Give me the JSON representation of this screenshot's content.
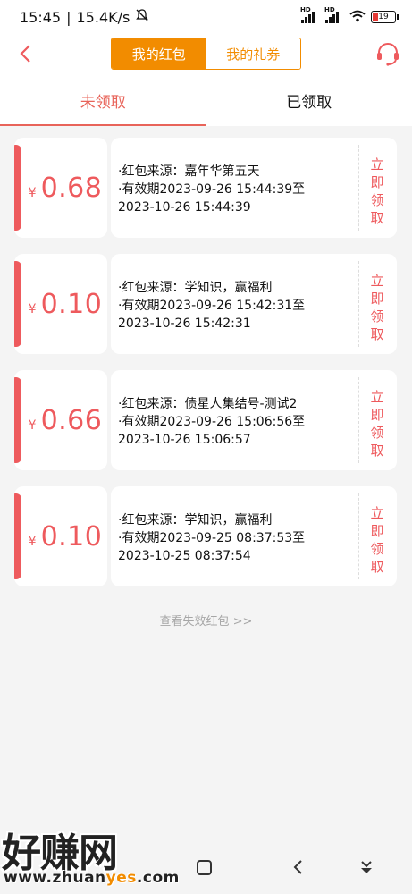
{
  "status_bar": {
    "time": "15:45",
    "speed": "15.4K/s",
    "battery": "19"
  },
  "header": {
    "tabs": [
      "我的红包",
      "我的礼券"
    ],
    "active_tab": 0
  },
  "subtabs": {
    "items": [
      "未领取",
      "已领取"
    ],
    "active": 0
  },
  "cards": [
    {
      "currency": "¥",
      "amount": "0.68",
      "source": "·红包来源：嘉年华第五天",
      "validity_line1": "·有效期2023-09-26 15:44:39至",
      "validity_line2": "2023-10-26 15:44:39",
      "claim": [
        "立",
        "即",
        "领",
        "取"
      ]
    },
    {
      "currency": "¥",
      "amount": "0.10",
      "source": "·红包来源：学知识，赢福利",
      "validity_line1": "·有效期2023-09-26 15:42:31至",
      "validity_line2": "2023-10-26 15:42:31",
      "claim": [
        "立",
        "即",
        "领",
        "取"
      ]
    },
    {
      "currency": "¥",
      "amount": "0.66",
      "source": "·红包来源：债星人集结号-测试2",
      "validity_line1": "·有效期2023-09-26 15:06:56至",
      "validity_line2": "2023-10-26 15:06:57",
      "claim": [
        "立",
        "即",
        "领",
        "取"
      ]
    },
    {
      "currency": "¥",
      "amount": "0.10",
      "source": "·红包来源：学知识，赢福利",
      "validity_line1": "·有效期2023-09-25 08:37:53至",
      "validity_line2": "2023-10-25 08:37:54",
      "claim": [
        "立",
        "即",
        "领",
        "取"
      ]
    }
  ],
  "view_expired": "查看失效红包 >>",
  "watermark": {
    "big": "好赚网",
    "url_prefix": "www.zhuan",
    "url_highlight": "yes",
    "url_suffix": ".com"
  },
  "colors": {
    "accent_orange": "#f28c00",
    "accent_red": "#ee5a5d",
    "background": "#f4f4f4"
  }
}
